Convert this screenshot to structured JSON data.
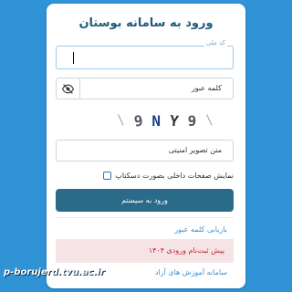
{
  "login": {
    "title": "ورود به سامانه بوستان",
    "code_label": "کد ملی",
    "code_value": "",
    "password_label": "کلمه عبور",
    "captcha_chars": [
      "9",
      "N",
      "Y",
      "9"
    ],
    "captcha_field_label": "متن تصویر امنیتی",
    "remember_label": "نمایش صفحات داخلی بصورت دسکتاپ",
    "remember_checked": false,
    "login_button": "ورود به سیستم",
    "recover_link": "بازیابی کلمه عبور",
    "notice_text": "پیش ثبت‌نام ورودی ۱۴۰۴",
    "system_link": "سامانه آموزش های آزاد"
  },
  "footer": {
    "domain": "p-borujerd.tvu.ac.ir"
  },
  "colors": {
    "background": "#2f93d6",
    "button": "#2a6b8a",
    "link": "#3e8fd0",
    "notice_bg": "#f6e3e6",
    "notice_text": "#b8283b"
  },
  "icons": {
    "eye": "eye-slash-icon"
  }
}
